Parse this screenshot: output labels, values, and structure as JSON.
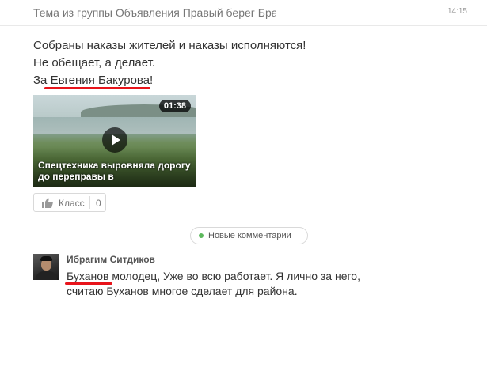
{
  "topic": {
    "title": "Тема из группы Объявления Правый берег Бра",
    "time": "14:15"
  },
  "post": {
    "lines": [
      "Собраны наказы жителей и наказы исполняются!",
      "Не обещает, а делает.",
      "За Евгения Бакурова!"
    ],
    "video": {
      "duration": "01:38",
      "caption": "Спецтехника выровняла дорогу до переправы в"
    },
    "like": {
      "label": "Класс",
      "count": "0"
    }
  },
  "comments": {
    "new_label": "Новые комментарии",
    "items": [
      {
        "author": "Ибрагим Ситдиков",
        "lines": [
          "Буханов молодец,  Уже во всю работает. Я лично за него,",
          "считаю Буханов многое сделает для района."
        ]
      }
    ]
  },
  "colors": {
    "accent_underline": "#e8141b",
    "new_dot": "#5cb85c"
  }
}
